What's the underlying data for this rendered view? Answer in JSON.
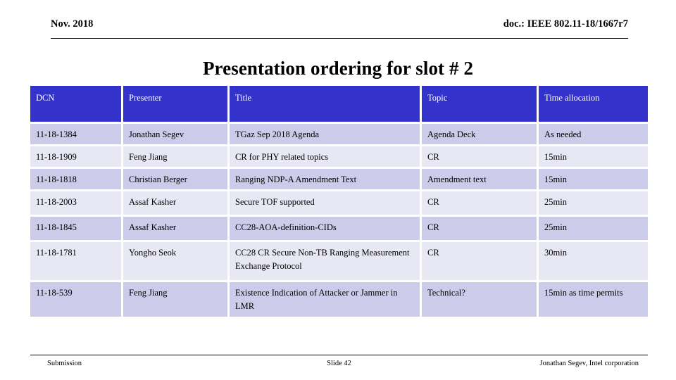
{
  "header": {
    "date": "Nov. 2018",
    "doc": "doc.: IEEE 802.11-18/1667r7"
  },
  "title": "Presentation ordering for slot # 2",
  "table": {
    "columns": [
      "DCN",
      "Presenter",
      "Title",
      "Topic",
      "Time allocation"
    ],
    "header_bg": "#3333cc",
    "header_text_color": "#ffffff",
    "row_bg_dark": "#ccccea",
    "row_bg_light": "#e8e8f4",
    "rows": [
      {
        "dcn": "11-18-1384",
        "presenter": "Jonathan Segev",
        "title": "TGaz Sep 2018 Agenda",
        "topic": "Agenda Deck",
        "time": "As needed"
      },
      {
        "dcn": "11-18-1909",
        "presenter": "Feng Jiang",
        "title": "CR for PHY related topics",
        "topic": "CR",
        "time": "15min"
      },
      {
        "dcn": "11-18-1818",
        "presenter": "Christian Berger",
        "title": "Ranging NDP-A Amendment Text",
        "topic": "Amendment text",
        "time": "15min"
      },
      {
        "dcn": "11-18-2003",
        "presenter": "Assaf Kasher",
        "title": "Secure TOF supported",
        "topic": "CR",
        "time": "25min"
      },
      {
        "dcn": "11-18-1845",
        "presenter": "Assaf Kasher",
        "title": "CC28-AOA-definition-CIDs",
        "topic": "CR",
        "time": "25min"
      },
      {
        "dcn": "11-18-1781",
        "presenter": "Yongho Seok",
        "title": "CC28 CR Secure Non-TB Ranging Measurement Exchange Protocol",
        "topic": "CR",
        "time": "30min"
      },
      {
        "dcn": "11-18-539",
        "presenter": "Feng Jiang",
        "title": "Existence Indication of Attacker or Jammer in LMR",
        "topic": "Technical?",
        "time": "15min as time permits"
      }
    ]
  },
  "footer": {
    "left": "Submission",
    "center": "Slide 42",
    "right": "Jonathan Segev, Intel corporation"
  }
}
